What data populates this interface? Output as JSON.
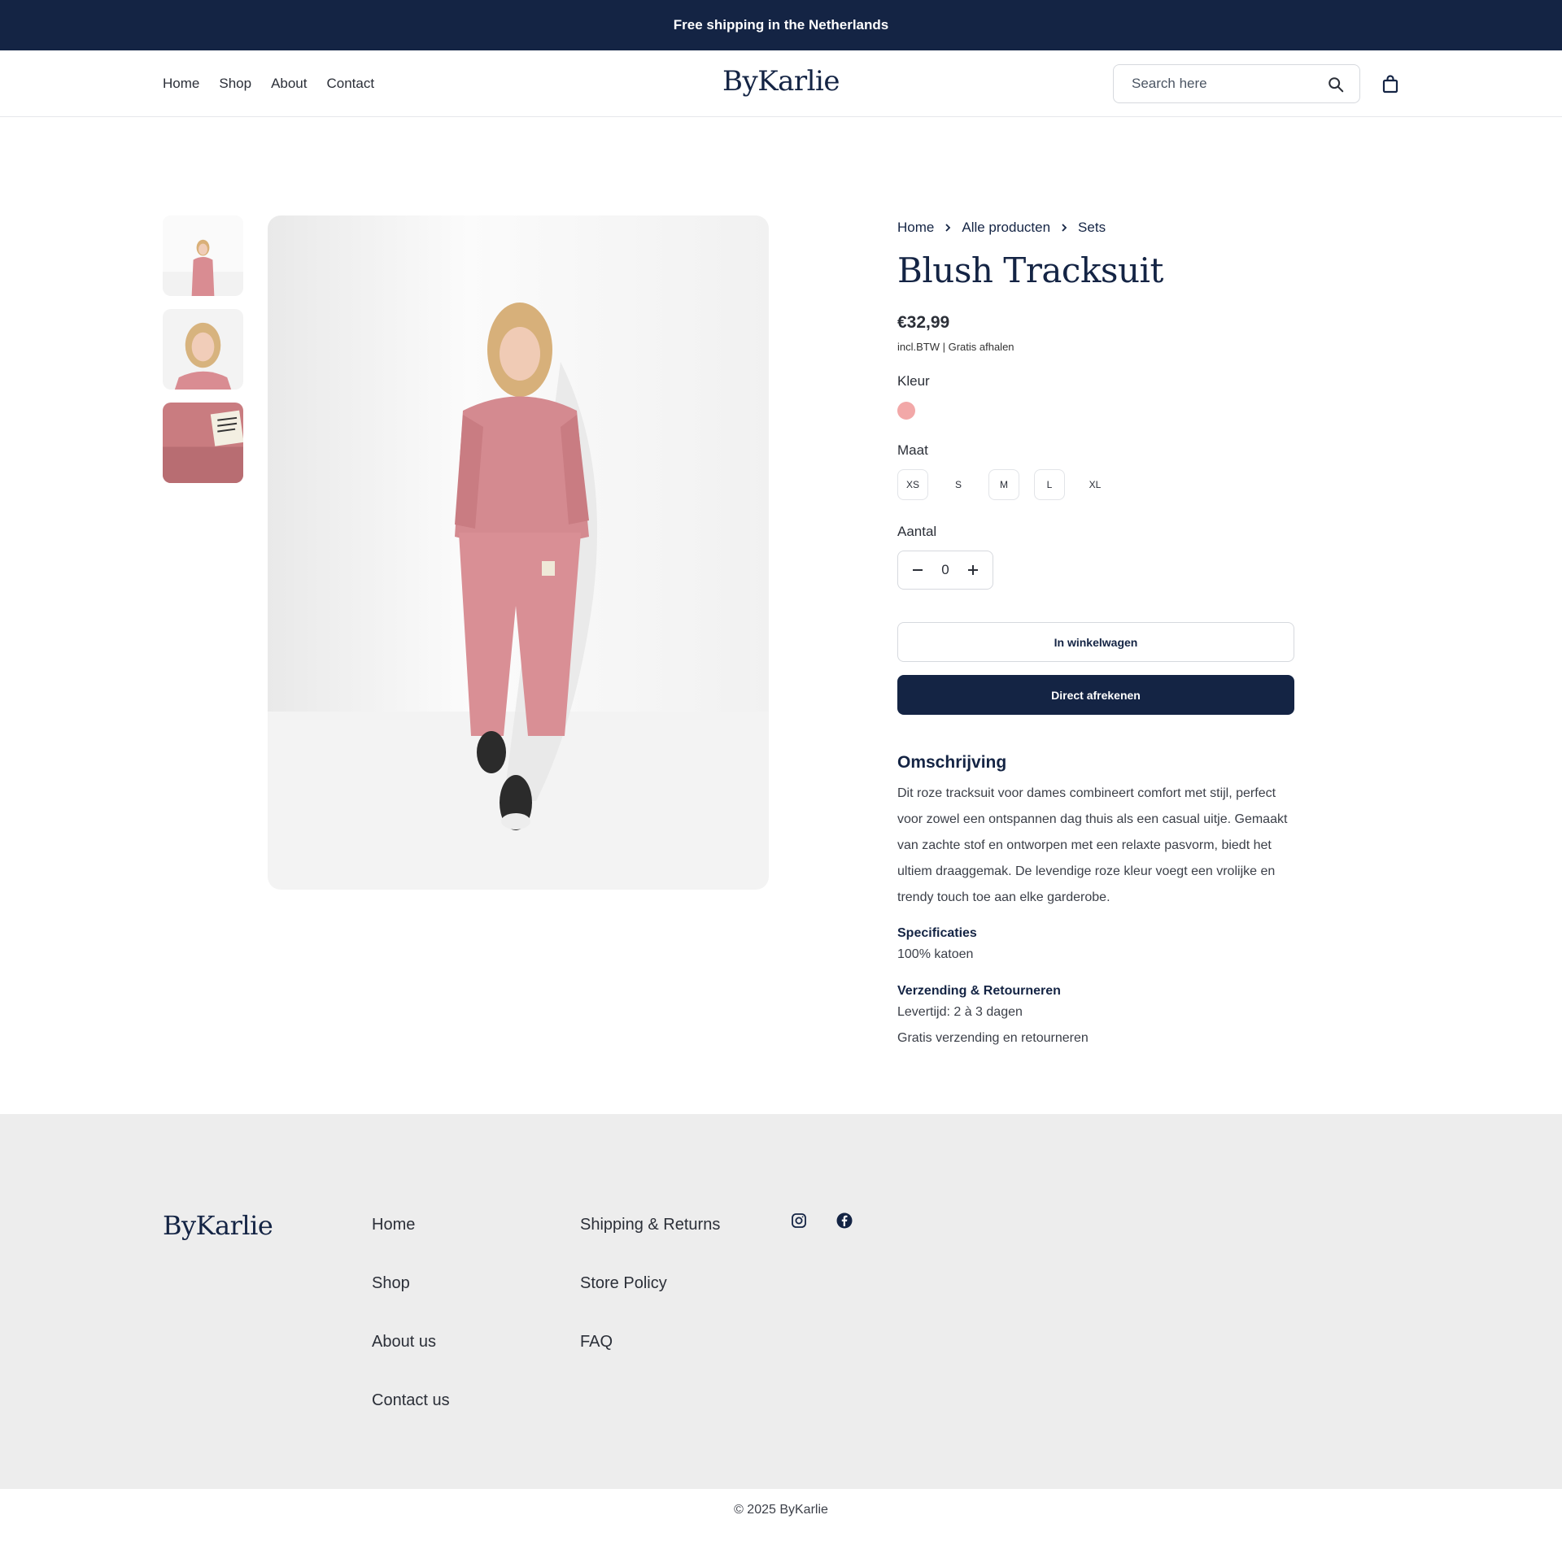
{
  "announcement": "Free shipping in the Netherlands",
  "nav": {
    "items": [
      "Home",
      "Shop",
      "About",
      "Contact"
    ]
  },
  "brand": "ByKarlie",
  "search": {
    "placeholder": "Search here",
    "value": ""
  },
  "breadcrumb": [
    "Home",
    "Alle producten",
    "Sets"
  ],
  "product": {
    "title": "Blush Tracksuit",
    "price": "€32,99",
    "price_note": "incl.BTW | Gratis afhalen",
    "color_label": "Kleur",
    "color_swatch": "#f2a8a8",
    "size_label": "Maat",
    "sizes": [
      "XS",
      "S",
      "M",
      "L",
      "XL"
    ],
    "qty_label": "Aantal",
    "qty_value": "0",
    "add_to_cart": "In winkelwagen",
    "buy_now": "Direct afrekenen"
  },
  "description": {
    "heading": "Omschrijving",
    "text": "Dit roze tracksuit voor dames combineert comfort met stijl, perfect voor zowel een ontspannen dag thuis als een casual uitje. Gemaakt van zachte stof en ontworpen met een relaxte pasvorm, biedt het ultiem draaggemak. De levendige roze kleur voegt een vrolijke en trendy touch toe aan elke garderobe.",
    "spec_heading": "Specificaties",
    "spec_text": "100% katoen",
    "shipping_heading": "Verzending & Retourneren",
    "shipping_lines": [
      "Levertijd: 2 à 3 dagen",
      "Gratis verzending en retourneren"
    ]
  },
  "footer": {
    "brand": "ByKarlie",
    "col1": [
      "Home",
      "Shop",
      "About us",
      "Contact us"
    ],
    "col2": [
      "Shipping & Returns",
      "Store Policy",
      "FAQ"
    ],
    "social": [
      "instagram-icon",
      "facebook-icon"
    ],
    "copyright": "© 2025 ByKarlie"
  },
  "colors": {
    "navy": "#142444",
    "footer_bg": "#ededed",
    "pink": "#f2a8a8"
  }
}
